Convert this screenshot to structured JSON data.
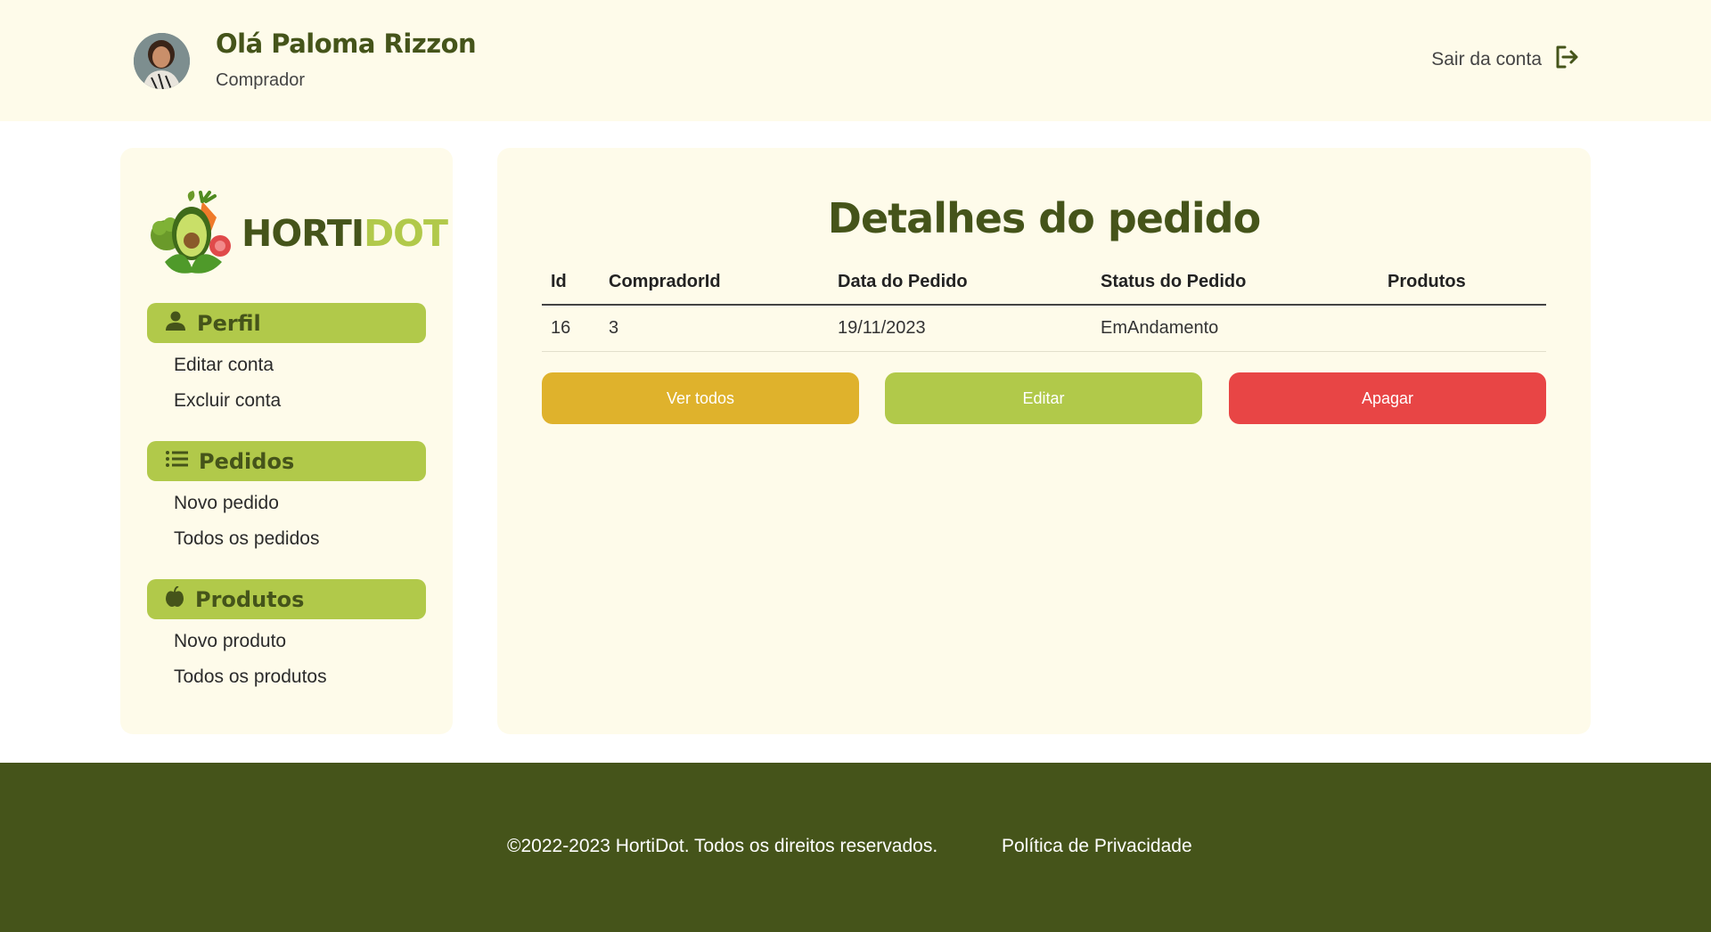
{
  "header": {
    "greeting": "Olá Paloma Rizzon",
    "role": "Comprador",
    "logout_label": "Sair da conta",
    "logout_icon": "logout-icon"
  },
  "sidebar": {
    "logo": {
      "text_a": "HORTI",
      "text_b": "DOT"
    },
    "sections": [
      {
        "label": "Perfil",
        "icon": "person-icon",
        "links": [
          "Editar conta",
          "Excluir conta"
        ]
      },
      {
        "label": "Pedidos",
        "icon": "list-icon",
        "links": [
          "Novo pedido",
          "Todos os pedidos"
        ]
      },
      {
        "label": "Produtos",
        "icon": "apple-icon",
        "links": [
          "Novo produto",
          "Todos os produtos"
        ]
      }
    ]
  },
  "main": {
    "title": "Detalhes do pedido",
    "table": {
      "headers": [
        "Id",
        "CompradorId",
        "Data do Pedido",
        "Status do Pedido",
        "Produtos"
      ],
      "rows": [
        [
          "16",
          "3",
          "19/11/2023",
          "EmAndamento",
          ""
        ]
      ]
    },
    "buttons": {
      "view_all": "Ver todos",
      "edit": "Editar",
      "delete": "Apagar"
    }
  },
  "footer": {
    "copyright": "©2022-2023 HortiDot. Todos os direitos reservados.",
    "privacy": "Política de Privacidade"
  },
  "colors": {
    "brand_dark": "#45541a",
    "brand_light": "#b1c94a",
    "background_cream": "#fefbea",
    "view_all_button": "#dfb22c",
    "edit_button": "#b1c94a",
    "delete_button": "#e84545"
  }
}
